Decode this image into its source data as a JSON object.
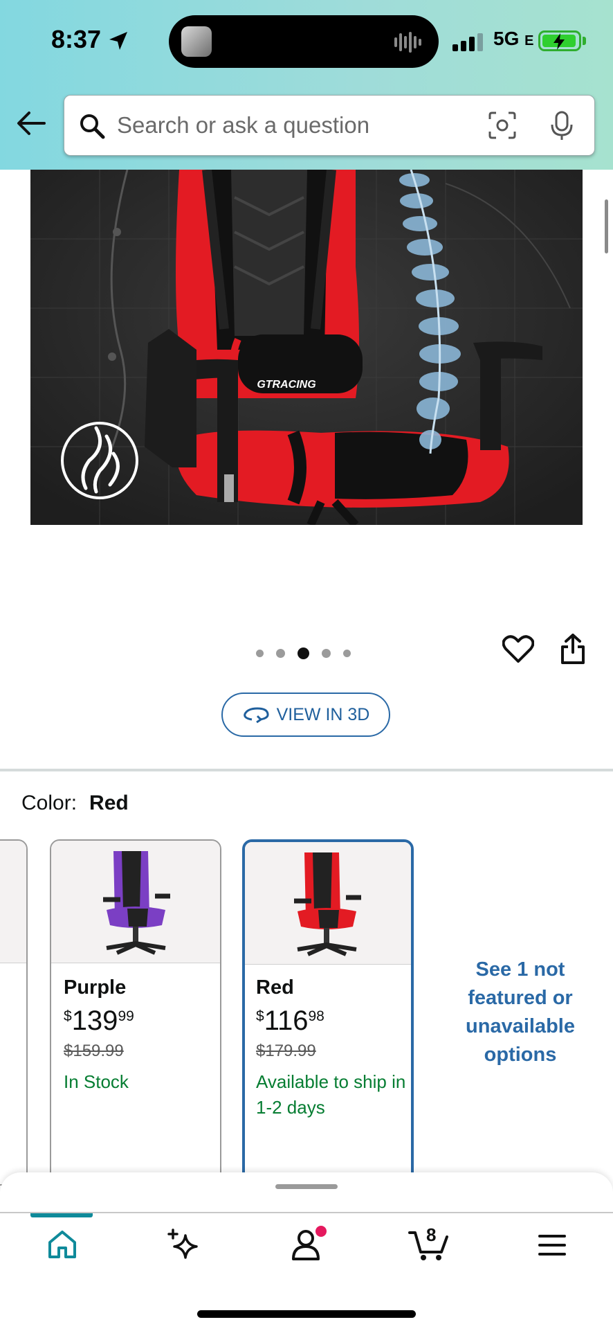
{
  "status_bar": {
    "time": "8:37",
    "network": "5G",
    "network_suffix": "E"
  },
  "search": {
    "placeholder": "Search or ask a question"
  },
  "product_image": {
    "brand_label": "GTRACING"
  },
  "view3d": {
    "label": "VIEW IN 3D"
  },
  "color": {
    "label": "Color:",
    "value": "Red"
  },
  "variants": [
    {
      "name": "Purple",
      "currency": "$",
      "price_whole": "139",
      "price_cents": "99",
      "list_price": "$159.99",
      "availability": "In Stock"
    },
    {
      "name": "Red",
      "currency": "$",
      "price_whole": "116",
      "price_cents": "98",
      "list_price": "$179.99",
      "availability": "Available to ship in 1-2 days"
    }
  ],
  "see_more": "See 1 not featured or unavailable options",
  "cart_count": "8",
  "icons": [
    "back-arrow-icon",
    "search-icon",
    "camera-lens-icon",
    "microphone-icon",
    "heart-icon",
    "share-icon",
    "view-3d-icon",
    "home-icon",
    "sparkle-icon",
    "account-icon",
    "cart-icon",
    "menu-icon"
  ],
  "colors": {
    "accent": "#2a69a6",
    "in_stock": "#067d32",
    "header_start": "#83d8e0",
    "header_end": "#a6e2cf",
    "chair_red": "#e31b23"
  }
}
